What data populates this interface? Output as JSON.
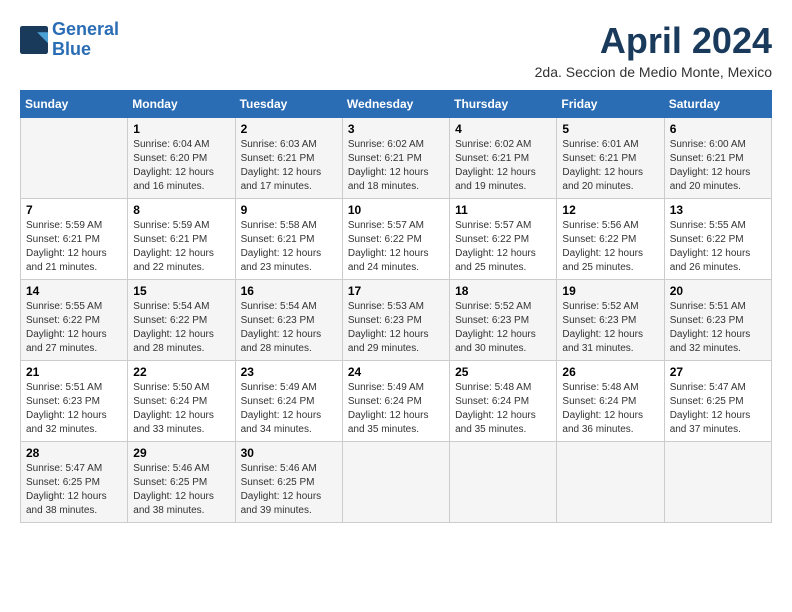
{
  "logo": {
    "line1": "General",
    "line2": "Blue"
  },
  "title": "April 2024",
  "location": "2da. Seccion de Medio Monte, Mexico",
  "columns": [
    "Sunday",
    "Monday",
    "Tuesday",
    "Wednesday",
    "Thursday",
    "Friday",
    "Saturday"
  ],
  "weeks": [
    [
      {
        "day": "",
        "sunrise": "",
        "sunset": "",
        "daylight": ""
      },
      {
        "day": "1",
        "sunrise": "Sunrise: 6:04 AM",
        "sunset": "Sunset: 6:20 PM",
        "daylight": "Daylight: 12 hours and 16 minutes."
      },
      {
        "day": "2",
        "sunrise": "Sunrise: 6:03 AM",
        "sunset": "Sunset: 6:21 PM",
        "daylight": "Daylight: 12 hours and 17 minutes."
      },
      {
        "day": "3",
        "sunrise": "Sunrise: 6:02 AM",
        "sunset": "Sunset: 6:21 PM",
        "daylight": "Daylight: 12 hours and 18 minutes."
      },
      {
        "day": "4",
        "sunrise": "Sunrise: 6:02 AM",
        "sunset": "Sunset: 6:21 PM",
        "daylight": "Daylight: 12 hours and 19 minutes."
      },
      {
        "day": "5",
        "sunrise": "Sunrise: 6:01 AM",
        "sunset": "Sunset: 6:21 PM",
        "daylight": "Daylight: 12 hours and 20 minutes."
      },
      {
        "day": "6",
        "sunrise": "Sunrise: 6:00 AM",
        "sunset": "Sunset: 6:21 PM",
        "daylight": "Daylight: 12 hours and 20 minutes."
      }
    ],
    [
      {
        "day": "7",
        "sunrise": "Sunrise: 5:59 AM",
        "sunset": "Sunset: 6:21 PM",
        "daylight": "Daylight: 12 hours and 21 minutes."
      },
      {
        "day": "8",
        "sunrise": "Sunrise: 5:59 AM",
        "sunset": "Sunset: 6:21 PM",
        "daylight": "Daylight: 12 hours and 22 minutes."
      },
      {
        "day": "9",
        "sunrise": "Sunrise: 5:58 AM",
        "sunset": "Sunset: 6:21 PM",
        "daylight": "Daylight: 12 hours and 23 minutes."
      },
      {
        "day": "10",
        "sunrise": "Sunrise: 5:57 AM",
        "sunset": "Sunset: 6:22 PM",
        "daylight": "Daylight: 12 hours and 24 minutes."
      },
      {
        "day": "11",
        "sunrise": "Sunrise: 5:57 AM",
        "sunset": "Sunset: 6:22 PM",
        "daylight": "Daylight: 12 hours and 25 minutes."
      },
      {
        "day": "12",
        "sunrise": "Sunrise: 5:56 AM",
        "sunset": "Sunset: 6:22 PM",
        "daylight": "Daylight: 12 hours and 25 minutes."
      },
      {
        "day": "13",
        "sunrise": "Sunrise: 5:55 AM",
        "sunset": "Sunset: 6:22 PM",
        "daylight": "Daylight: 12 hours and 26 minutes."
      }
    ],
    [
      {
        "day": "14",
        "sunrise": "Sunrise: 5:55 AM",
        "sunset": "Sunset: 6:22 PM",
        "daylight": "Daylight: 12 hours and 27 minutes."
      },
      {
        "day": "15",
        "sunrise": "Sunrise: 5:54 AM",
        "sunset": "Sunset: 6:22 PM",
        "daylight": "Daylight: 12 hours and 28 minutes."
      },
      {
        "day": "16",
        "sunrise": "Sunrise: 5:54 AM",
        "sunset": "Sunset: 6:23 PM",
        "daylight": "Daylight: 12 hours and 28 minutes."
      },
      {
        "day": "17",
        "sunrise": "Sunrise: 5:53 AM",
        "sunset": "Sunset: 6:23 PM",
        "daylight": "Daylight: 12 hours and 29 minutes."
      },
      {
        "day": "18",
        "sunrise": "Sunrise: 5:52 AM",
        "sunset": "Sunset: 6:23 PM",
        "daylight": "Daylight: 12 hours and 30 minutes."
      },
      {
        "day": "19",
        "sunrise": "Sunrise: 5:52 AM",
        "sunset": "Sunset: 6:23 PM",
        "daylight": "Daylight: 12 hours and 31 minutes."
      },
      {
        "day": "20",
        "sunrise": "Sunrise: 5:51 AM",
        "sunset": "Sunset: 6:23 PM",
        "daylight": "Daylight: 12 hours and 32 minutes."
      }
    ],
    [
      {
        "day": "21",
        "sunrise": "Sunrise: 5:51 AM",
        "sunset": "Sunset: 6:23 PM",
        "daylight": "Daylight: 12 hours and 32 minutes."
      },
      {
        "day": "22",
        "sunrise": "Sunrise: 5:50 AM",
        "sunset": "Sunset: 6:24 PM",
        "daylight": "Daylight: 12 hours and 33 minutes."
      },
      {
        "day": "23",
        "sunrise": "Sunrise: 5:49 AM",
        "sunset": "Sunset: 6:24 PM",
        "daylight": "Daylight: 12 hours and 34 minutes."
      },
      {
        "day": "24",
        "sunrise": "Sunrise: 5:49 AM",
        "sunset": "Sunset: 6:24 PM",
        "daylight": "Daylight: 12 hours and 35 minutes."
      },
      {
        "day": "25",
        "sunrise": "Sunrise: 5:48 AM",
        "sunset": "Sunset: 6:24 PM",
        "daylight": "Daylight: 12 hours and 35 minutes."
      },
      {
        "day": "26",
        "sunrise": "Sunrise: 5:48 AM",
        "sunset": "Sunset: 6:24 PM",
        "daylight": "Daylight: 12 hours and 36 minutes."
      },
      {
        "day": "27",
        "sunrise": "Sunrise: 5:47 AM",
        "sunset": "Sunset: 6:25 PM",
        "daylight": "Daylight: 12 hours and 37 minutes."
      }
    ],
    [
      {
        "day": "28",
        "sunrise": "Sunrise: 5:47 AM",
        "sunset": "Sunset: 6:25 PM",
        "daylight": "Daylight: 12 hours and 38 minutes."
      },
      {
        "day": "29",
        "sunrise": "Sunrise: 5:46 AM",
        "sunset": "Sunset: 6:25 PM",
        "daylight": "Daylight: 12 hours and 38 minutes."
      },
      {
        "day": "30",
        "sunrise": "Sunrise: 5:46 AM",
        "sunset": "Sunset: 6:25 PM",
        "daylight": "Daylight: 12 hours and 39 minutes."
      },
      {
        "day": "",
        "sunrise": "",
        "sunset": "",
        "daylight": ""
      },
      {
        "day": "",
        "sunrise": "",
        "sunset": "",
        "daylight": ""
      },
      {
        "day": "",
        "sunrise": "",
        "sunset": "",
        "daylight": ""
      },
      {
        "day": "",
        "sunrise": "",
        "sunset": "",
        "daylight": ""
      }
    ]
  ]
}
